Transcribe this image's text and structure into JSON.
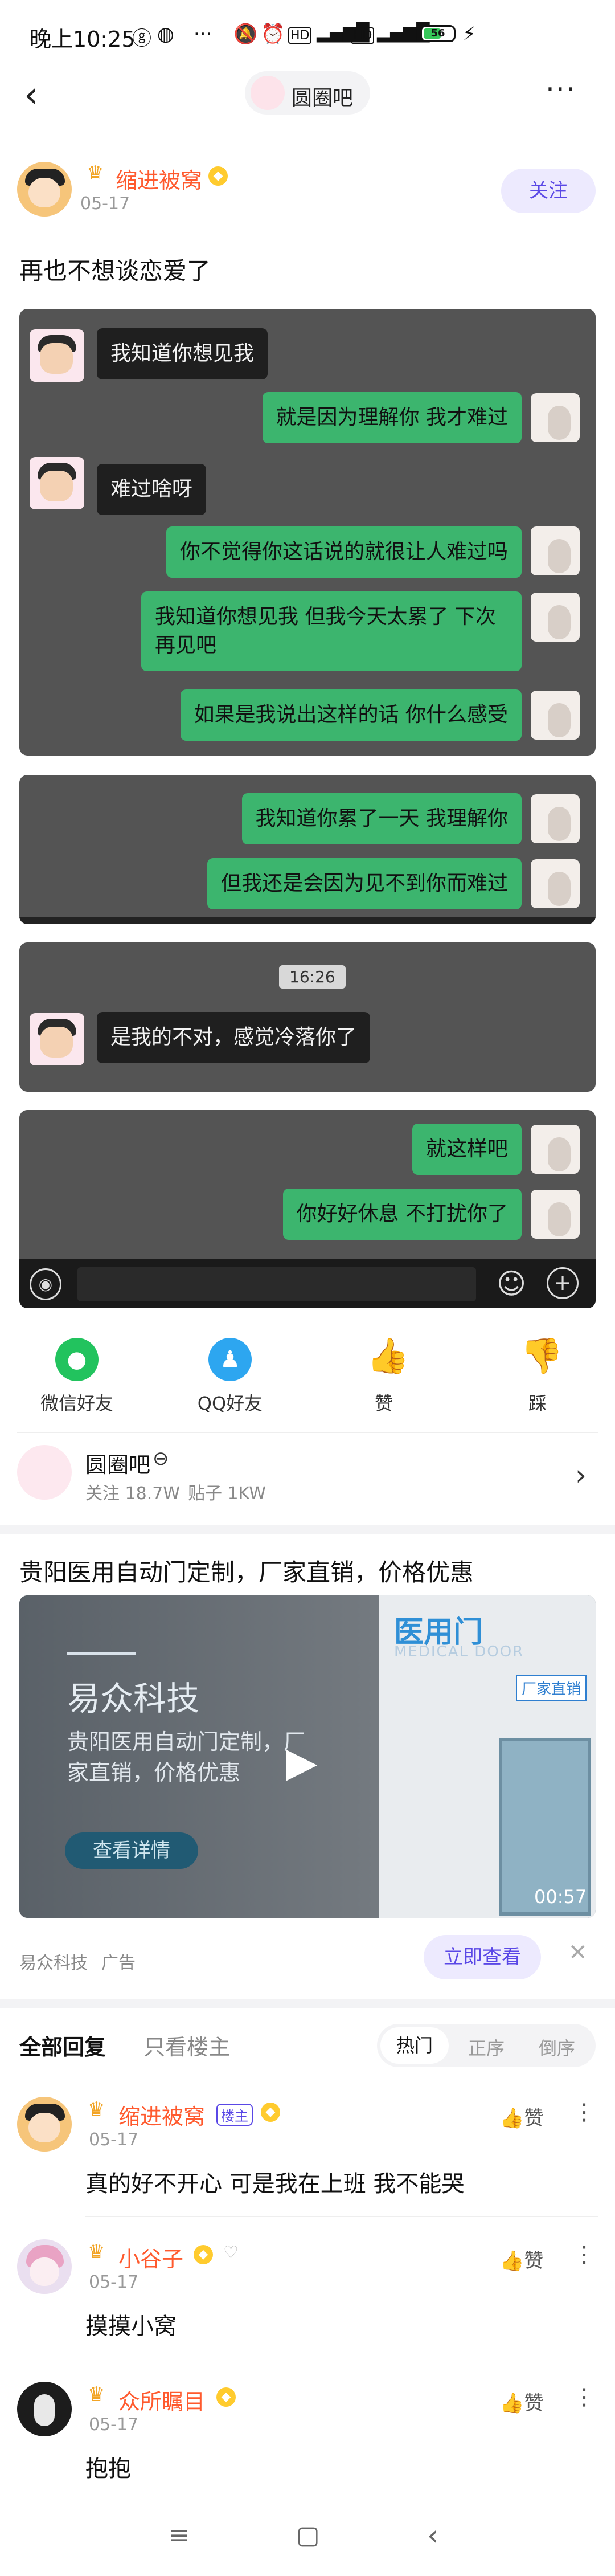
{
  "status_bar": {
    "time": "晚上10:25",
    "icons": [
      "weibo-icon",
      "wechat-icon",
      "more-icon",
      "mute-icon",
      "alarm-icon",
      "hd-icon",
      "signal-4g-icon",
      "hd-icon",
      "signal-4g-icon",
      "battery-icon",
      "charging-icon"
    ],
    "battery": "56"
  },
  "header": {
    "forum_name": "圆圈吧",
    "more": "···"
  },
  "post": {
    "author": "缩进被窝",
    "date": "05-17",
    "follow": "关注",
    "title": "再也不想谈恋爱了",
    "shots": [
      {
        "messages": [
          {
            "side": "left",
            "text": "我知道你想见我"
          },
          {
            "side": "right",
            "text": "就是因为理解你 我才难过"
          },
          {
            "side": "left",
            "text": "难过啥呀"
          },
          {
            "side": "right",
            "text": "你不觉得你这话说的就很让人难过吗"
          },
          {
            "side": "right",
            "text": "我知道你想见我 但我今天太累了 下次再见吧"
          },
          {
            "side": "right",
            "text": "如果是我说出这样的话 你什么感受"
          }
        ]
      },
      {
        "messages": [
          {
            "side": "right",
            "text": "我知道你累了一天 我理解你"
          },
          {
            "side": "right",
            "text": "但我还是会因为见不到你而难过"
          }
        ]
      },
      {
        "timestamp": "16:26",
        "messages": [
          {
            "side": "left",
            "text": "是我的不对，感觉冷落你了"
          }
        ]
      },
      {
        "messages": [
          {
            "side": "right",
            "text": "就这样吧"
          },
          {
            "side": "right",
            "text": "你好好休息 不打扰你了"
          }
        ]
      }
    ]
  },
  "share": [
    {
      "label": "微信好友",
      "icon": "wechat-icon",
      "color": "#22c35e"
    },
    {
      "label": "QQ好友",
      "icon": "qq-icon",
      "color": "#2da6f0"
    },
    {
      "label": "赞",
      "icon": "thumbs-up-icon",
      "color": "#333333"
    },
    {
      "label": "踩",
      "icon": "thumbs-down-icon",
      "color": "#333333"
    }
  ],
  "forum_card": {
    "name": "圆圈吧",
    "follows": "关注 18.7W",
    "posts": "贴子 1KW"
  },
  "ad": {
    "title": "贵阳医用自动门定制，厂家直销，价格优惠",
    "brand": "易众科技",
    "desc": "贵阳医用自动门定制，厂家直销，价格优惠",
    "cta": "查看详情",
    "door_title": "医用门",
    "door_sub": "MEDICAL DOOR",
    "door_tag": "厂家直销",
    "duration": "00:57",
    "source": "易众科技",
    "ad_label": "广告",
    "action": "立即查看"
  },
  "replies": {
    "tab_all": "全部回复",
    "tab_op": "只看楼主",
    "sort": [
      "热门",
      "正序",
      "倒序"
    ],
    "like_label": "赞",
    "op_badge": "楼主",
    "items": [
      {
        "name": "缩进被窝",
        "date": "05-17",
        "text": "真的好不开心 可是我在上班 我不能哭",
        "is_op": true
      },
      {
        "name": "小谷子",
        "date": "05-17",
        "text": "摸摸小窝",
        "is_op": false
      },
      {
        "name": "众所瞩目",
        "date": "05-17",
        "text": "抱抱",
        "is_op": false
      }
    ]
  },
  "colors": {
    "accent": "#5a48e6",
    "chat_green": "#3cb56e",
    "username": "#ff5a2e"
  }
}
